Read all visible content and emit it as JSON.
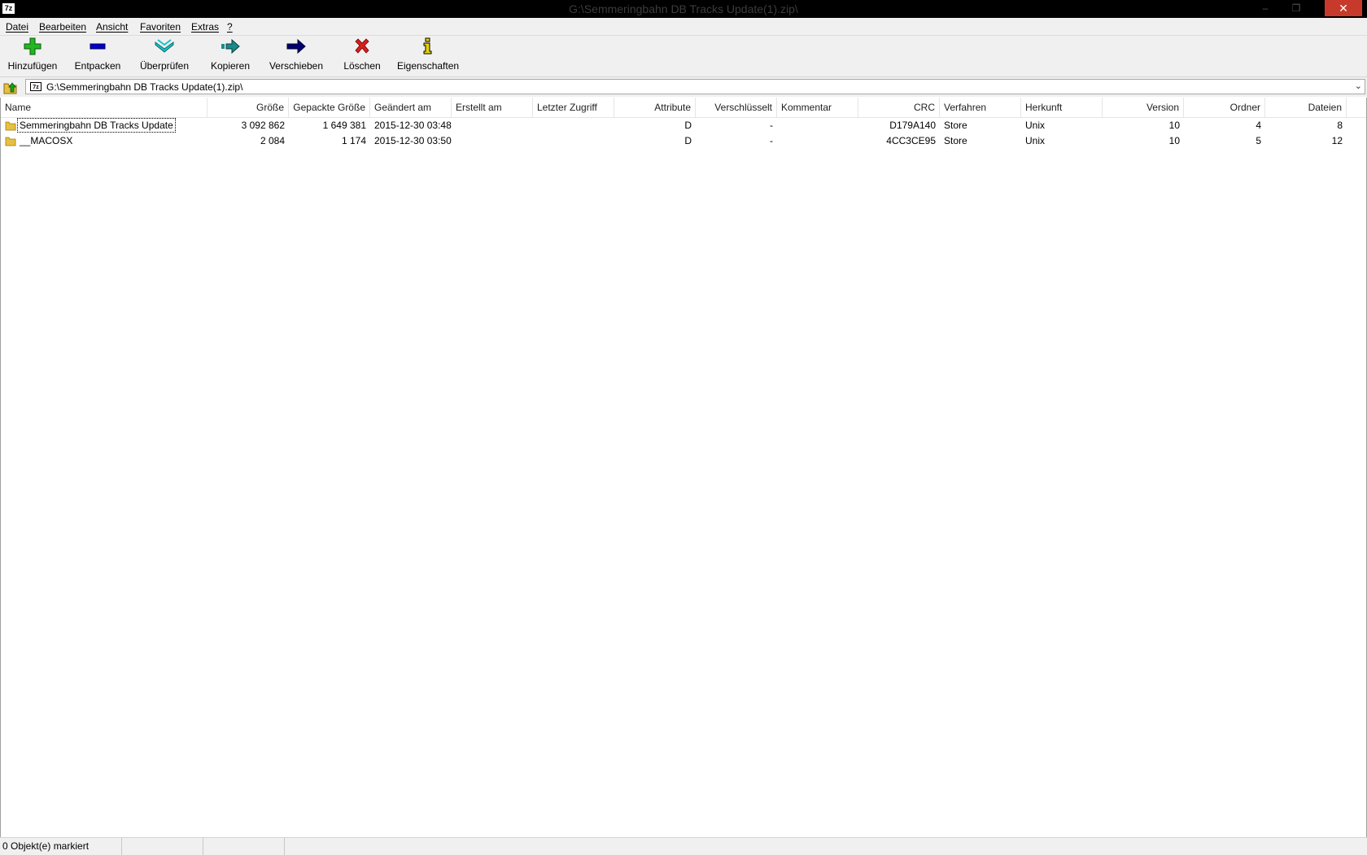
{
  "window": {
    "title": "G:\\Semmeringbahn DB Tracks Update(1).zip\\",
    "app_icon": "7z"
  },
  "menu": [
    "Datei",
    "Bearbeiten",
    "Ansicht",
    "Favoriten",
    "Extras",
    "?"
  ],
  "toolbar": {
    "add": "Hinzufügen",
    "extract": "Entpacken",
    "test": "Überprüfen",
    "copy": "Kopieren",
    "move": "Verschieben",
    "delete": "Löschen",
    "info": "Eigenschaften"
  },
  "address": {
    "path": "G:\\Semmeringbahn DB Tracks Update(1).zip\\"
  },
  "columns": {
    "name": "Name",
    "size": "Größe",
    "packed": "Gepackte Größe",
    "modified": "Geändert am",
    "created": "Erstellt am",
    "accessed": "Letzter Zugriff",
    "attributes": "Attribute",
    "encrypted": "Verschlüsselt",
    "comment": "Kommentar",
    "crc": "CRC",
    "method": "Verfahren",
    "host": "Herkunft",
    "version": "Version",
    "folders": "Ordner",
    "files": "Dateien"
  },
  "rows": [
    {
      "name": "Semmeringbahn DB Tracks Update",
      "size": "3 092 862",
      "packed": "1 649 381",
      "modified": "2015-12-30 03:48",
      "created": "",
      "accessed": "",
      "attributes": "D",
      "encrypted": "-",
      "comment": "",
      "crc": "D179A140",
      "method": "Store",
      "host": "Unix",
      "version": "10",
      "folders": "4",
      "files": "8"
    },
    {
      "name": "__MACOSX",
      "size": "2 084",
      "packed": "1 174",
      "modified": "2015-12-30 03:50",
      "created": "",
      "accessed": "",
      "attributes": "D",
      "encrypted": "-",
      "comment": "",
      "crc": "4CC3CE95",
      "method": "Store",
      "host": "Unix",
      "version": "10",
      "folders": "5",
      "files": "12"
    }
  ],
  "status": {
    "selected": "0 Objekt(e) markiert"
  },
  "colors": {
    "add_icon": "#22b822",
    "extract_icon": "#0000c8",
    "test_icon": "#19c3c8",
    "copy_icon": "#1a8a8a",
    "move_icon": "#00006e",
    "delete_icon": "#d81e1e",
    "info_icon": "#e6d400",
    "close_button": "#c7392b"
  }
}
